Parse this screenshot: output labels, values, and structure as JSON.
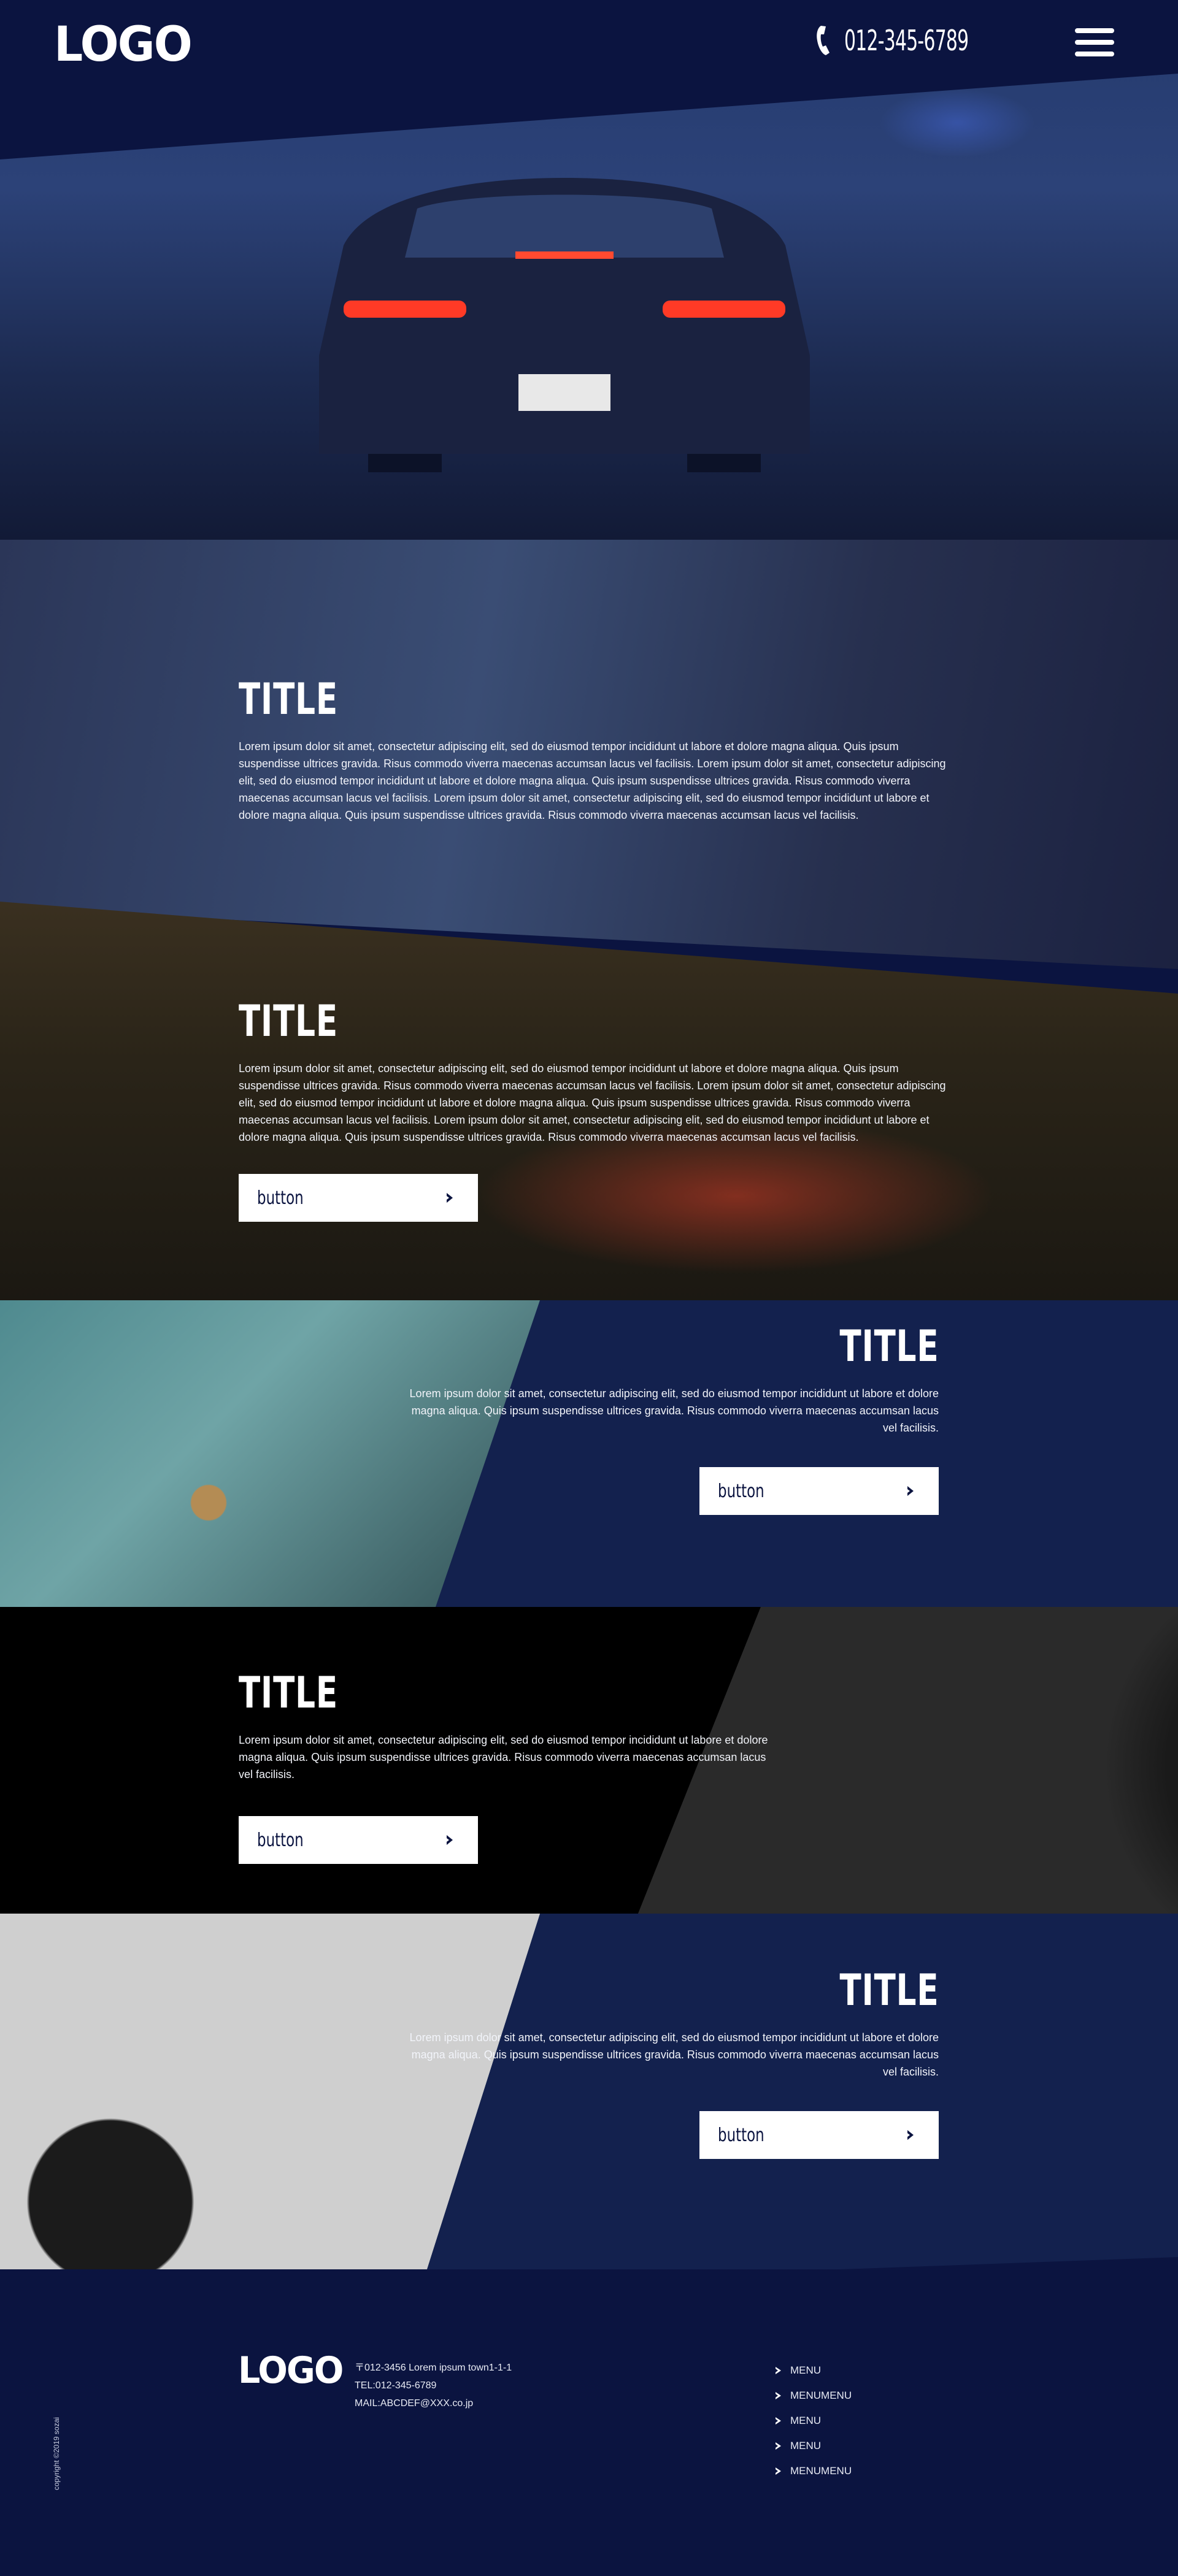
{
  "header": {
    "logo": "LOGO",
    "phone": "012-345-6789",
    "menu_icon": "hamburger-icon"
  },
  "sections": [
    {
      "title": "TITLE",
      "body": "Lorem ipsum dolor sit amet, consectetur adipiscing elit, sed do eiusmod tempor incididunt ut labore et dolore magna aliqua. Quis ipsum suspendisse ultrices gravida. Risus commodo viverra maecenas accumsan lacus vel facilisis. Lorem ipsum dolor sit amet, consectetur adipiscing elit, sed do eiusmod tempor incididunt ut labore et dolore magna aliqua. Quis ipsum suspendisse ultrices gravida. Risus commodo viverra maecenas accumsan lacus vel facilisis. Lorem ipsum dolor sit amet, consectetur adipiscing elit, sed do eiusmod tempor incididunt ut labore et dolore magna aliqua. Quis ipsum suspendisse ultrices gravida. Risus commodo viverra maecenas accumsan lacus vel facilisis."
    },
    {
      "title": "TITLE",
      "body": "Lorem ipsum dolor sit amet, consectetur adipiscing elit, sed do eiusmod tempor incididunt ut labore et dolore magna aliqua. Quis ipsum suspendisse ultrices gravida. Risus commodo viverra maecenas accumsan lacus vel facilisis. Lorem ipsum dolor sit amet, consectetur adipiscing elit, sed do eiusmod tempor incididunt ut labore et dolore magna aliqua. Quis ipsum suspendisse ultrices gravida. Risus commodo viverra maecenas accumsan lacus vel facilisis. Lorem ipsum dolor sit amet, consectetur adipiscing elit, sed do eiusmod tempor incididunt ut labore et dolore magna aliqua. Quis ipsum suspendisse ultrices gravida. Risus commodo viverra maecenas accumsan lacus vel facilisis.",
      "button": "button"
    },
    {
      "title": "TITLE",
      "body": "Lorem ipsum dolor sit amet, consectetur adipiscing elit, sed do eiusmod tempor incididunt ut labore et dolore magna aliqua. Quis ipsum suspendisse ultrices gravida. Risus commodo viverra maecenas accumsan lacus vel facilisis.",
      "button": "button"
    },
    {
      "title": "TITLE",
      "body": "Lorem ipsum dolor sit amet, consectetur adipiscing elit, sed do eiusmod tempor incididunt ut labore et dolore magna aliqua. Quis ipsum suspendisse ultrices gravida. Risus commodo viverra maecenas accumsan lacus vel facilisis.",
      "button": "button"
    },
    {
      "title": "TITLE",
      "body": "Lorem ipsum dolor sit amet, consectetur adipiscing elit, sed do eiusmod tempor incididunt ut labore et dolore magna aliqua. Quis ipsum suspendisse ultrices gravida. Risus commodo viverra maecenas accumsan lacus vel facilisis.",
      "button": "button"
    }
  ],
  "footer": {
    "logo": "LOGO",
    "address": "〒012-3456 Lorem ipsum town1-1-1",
    "tel": "TEL:012-345-6789",
    "mail": "MAIL:ABCDEF@XXX.co.jp",
    "menu": [
      "MENU",
      "MENUMENU",
      "MENU",
      "MENU",
      "MENUMENU"
    ],
    "copyright": "copyright ©2019 sozai"
  },
  "colors": {
    "navy": "#0b1440",
    "section_blue": "#13214e",
    "black": "#000000",
    "button_bg": "#ffffff",
    "button_text": "#0b1440"
  }
}
